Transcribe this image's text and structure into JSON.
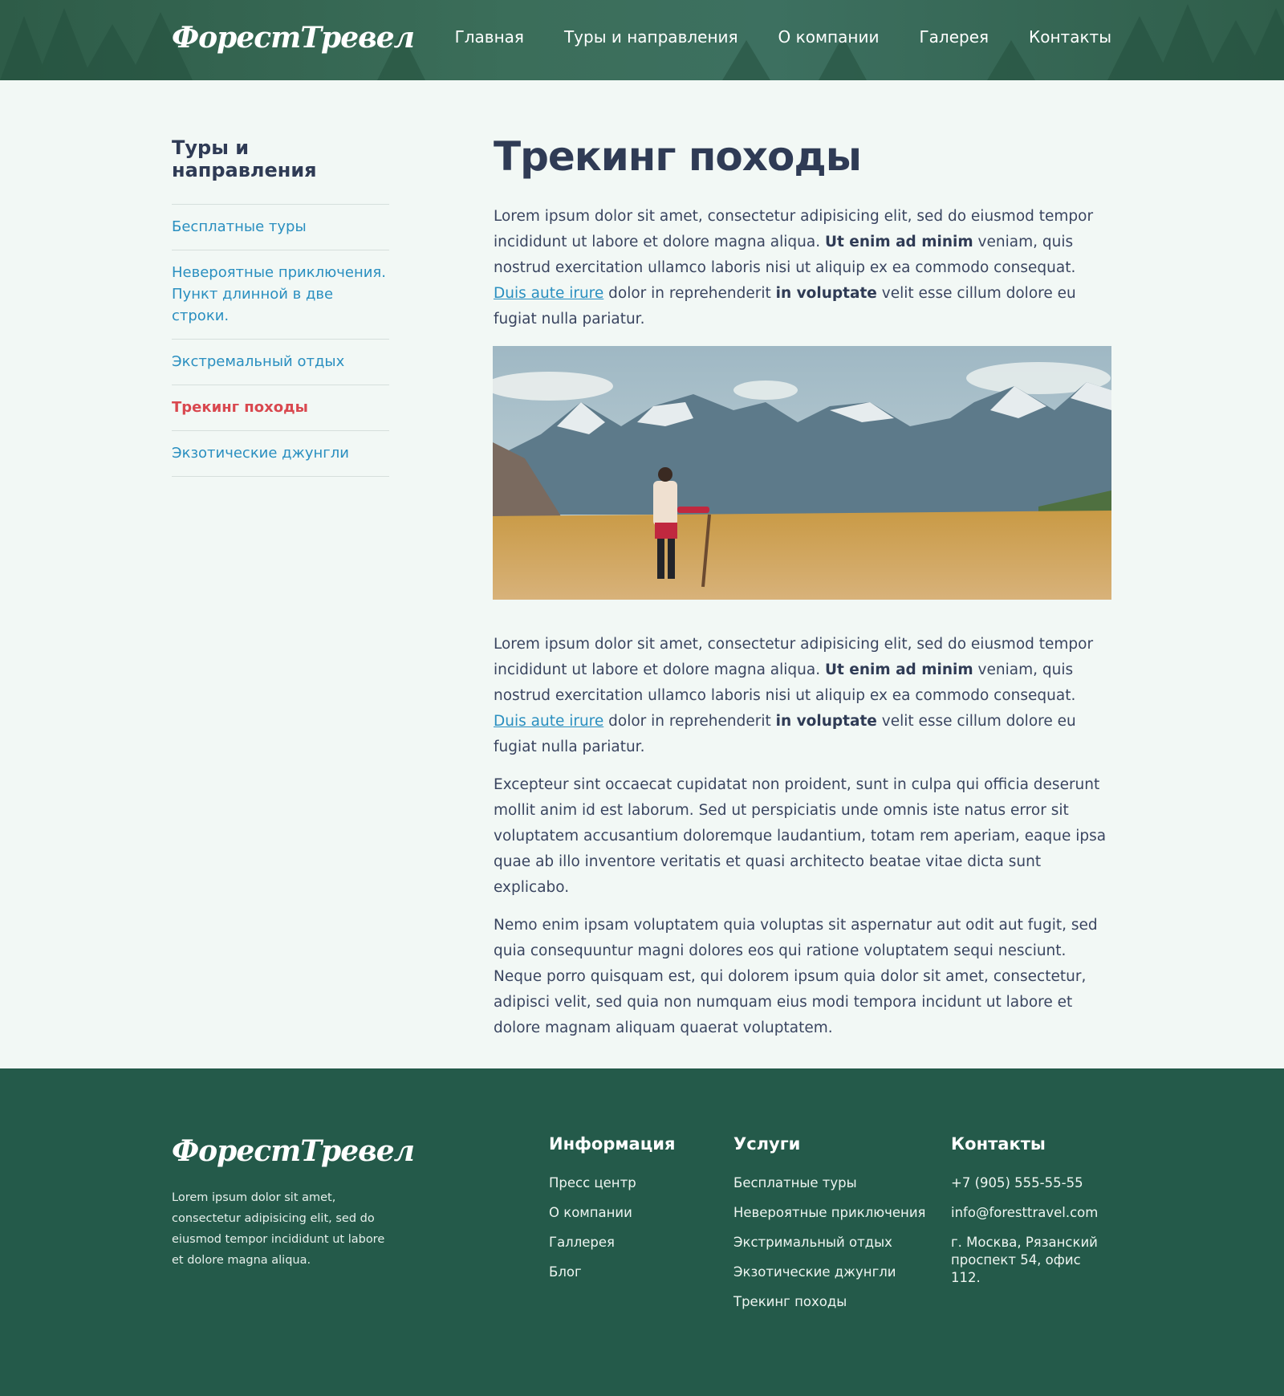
{
  "header": {
    "logo": "ФорестТревел",
    "nav": [
      "Главная",
      "Туры и направления",
      "О компании",
      "Галерея",
      "Контакты"
    ]
  },
  "sidebar": {
    "title": "Туры и направления",
    "items": [
      {
        "label": "Бесплатные туры"
      },
      {
        "label": "Невероятные приключения. Пункт длинной в две строки."
      },
      {
        "label": "Экстремальный отдых"
      },
      {
        "label": "Трекинг походы",
        "active": true
      },
      {
        "label": "Экзотические джунгли"
      }
    ]
  },
  "main": {
    "title": "Трекинг походы",
    "p1": {
      "a": "Lorem ipsum dolor sit amet, consectetur adipisicing elit, sed do eiusmod tempor incidi­dunt ut labore et dolore magna aliqua. ",
      "b1": "Ut enim ad minim",
      "c": " veniam, quis nostrud exercita­tion ullamco laboris nisi ut aliquip ex ea commodo consequat. ",
      "link": "Duis aute irure",
      "d": " dolor in rep­rehenderit ",
      "b2": "in voluptate",
      "e": " velit esse cillum dolore eu fugiat nulla pariatur."
    },
    "image_alt": "hiker-in-mountains-photo",
    "p2": {
      "a": "Lorem ipsum dolor sit amet, consectetur adipisicing elit, sed do eiusmod tempor incidi­dunt ut labore et dolore magna aliqua. ",
      "b1": "Ut enim ad minim",
      "c": " veniam, quis nostrud exercita­tion ullamco laboris nisi ut aliquip ex ea commodo consequat. ",
      "link": "Duis aute irure",
      "d": " dolor in rep­rehenderit ",
      "b2": "in voluptate",
      "e": " velit esse cillum dolore eu fugiat nulla pariatur."
    },
    "p3": "Excepteur sint occaecat cupidatat non proident, sunt in culpa qui officia deserunt mollit anim id est laborum. Sed ut perspiciatis unde omnis iste natus error sit voluptatem accu­santium doloremque laudantium, totam rem aperiam, eaque ipsa quae ab illo inventore veritatis et quasi architecto beatae vitae dicta sunt explicabo.",
    "p4": "Nemo enim ipsam voluptatem quia voluptas sit aspernatur aut odit aut fugit, sed quia consequuntur magni dolores eos qui ratione voluptatem sequi nesciunt. Neque porro quis­quam est, qui dolorem ipsum quia dolor sit amet, consectetur, adipisci velit, sed quia non numquam eius modi tempora incidunt ut labore et dolore magnam aliquam quaerat vo­luptatem."
  },
  "footer": {
    "logo": "ФорестТревел",
    "about": "Lorem ipsum dolor sit amet, consecte­tur adipisicing elit, sed do eiusmod tempor incididunt ut labore et dolore magna aliqua.",
    "info": {
      "title": "Информация",
      "items": [
        "Пресс центр",
        "О компании",
        "Галлерея",
        "Блог"
      ]
    },
    "services": {
      "title": "Услуги",
      "items": [
        "Бесплатные туры",
        "Невероятные приключения",
        "Экстримальный отдых",
        "Экзотические джунгли",
        "Трекинг походы"
      ]
    },
    "contacts": {
      "title": "Контакты",
      "phone": "+7 (905) 555-55-55",
      "email": "info@foresttravel.com",
      "address": "г. Москва, Рязанский проспект 54, офис 112."
    }
  },
  "colors": {
    "header_bg": "#2f5e4a",
    "footer_bg": "#245a4a",
    "page_bg": "#f2f8f5",
    "link": "#2a8fc0",
    "active": "#d9484f",
    "heading": "#2f3b55"
  }
}
